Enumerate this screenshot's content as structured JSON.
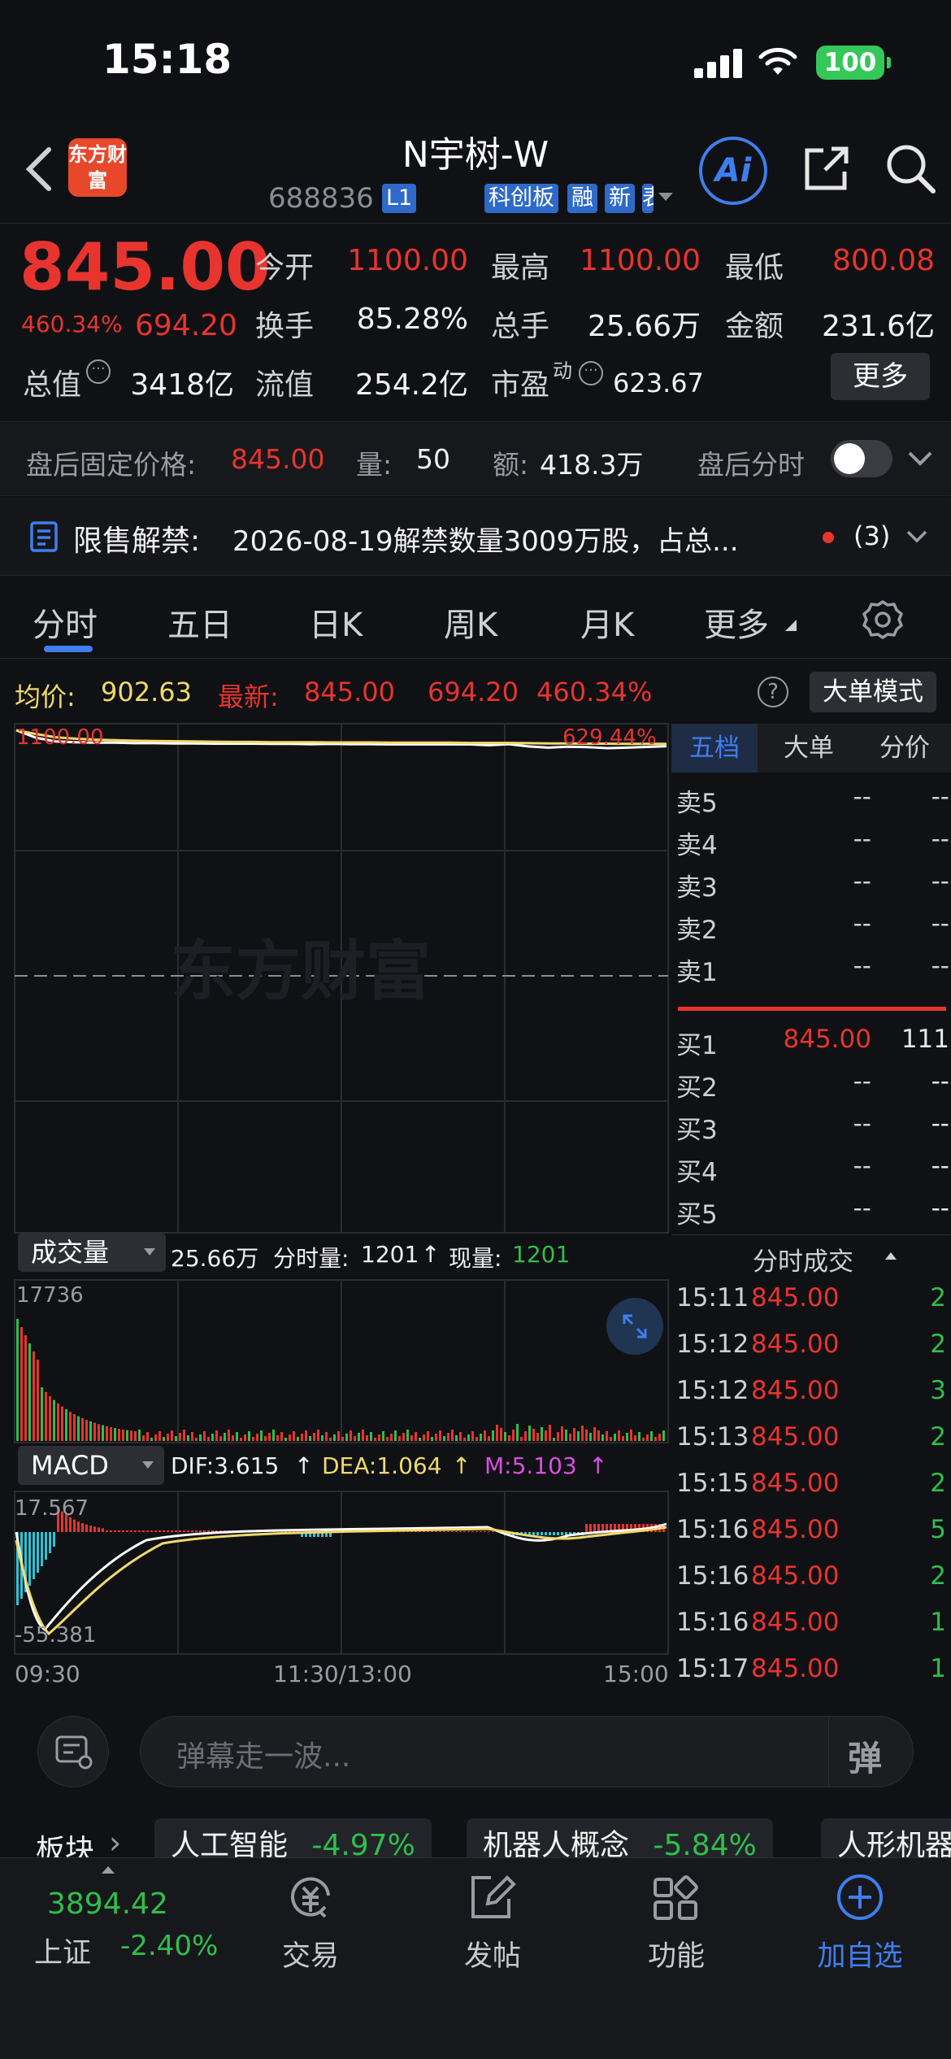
{
  "status_bar": {
    "time": "15:18",
    "battery": "100"
  },
  "header": {
    "stock_name": "N宇树-W",
    "stock_code": "688836",
    "tags": [
      "L1",
      "科创板",
      "融",
      "新",
      "表"
    ],
    "logo_text": "东方财富"
  },
  "quote": {
    "price": "845.00",
    "change_pct": "460.34%",
    "change": "694.20",
    "open_label": "今开",
    "open": "1100.00",
    "high_label": "最高",
    "high": "1100.00",
    "low_label": "最低",
    "low": "800.08",
    "turnover_label": "换手",
    "turnover": "85.28%",
    "volume_label": "总手",
    "volume": "25.66万",
    "amount_label": "金额",
    "amount": "231.6亿",
    "mktcap_label": "总值",
    "mktcap": "3418亿",
    "float_label": "流值",
    "float_cap": "254.2亿",
    "pe_label": "市盈",
    "pe_sup": "动",
    "pe": "623.67",
    "more_button": "更多"
  },
  "after_hours": {
    "label": "盘后固定价格:",
    "price": "845.00",
    "vol_label": "量:",
    "vol": "50",
    "amt_label": "额:",
    "amt": "418.3万",
    "timeshare_label": "盘后分时"
  },
  "restrict_notice": {
    "label": "限售解禁:",
    "text": "2026-08-19解禁数量3009万股，占总...",
    "count": "(3)"
  },
  "tabs": [
    "分时",
    "五日",
    "日K",
    "周K",
    "月K",
    "更多"
  ],
  "chart_legend": {
    "avg_label": "均价:",
    "avg": "902.63",
    "latest_label": "最新:",
    "latest": "845.00",
    "change": "694.20",
    "pct": "460.34%",
    "mode_button": "大单模式"
  },
  "chart_labels": {
    "top_price": "1100.00",
    "top_pct": "629.44%",
    "vol_selector": "成交量",
    "vol_total": "25.66万",
    "vol_minute_label": "分时量:",
    "vol_minute": "1201",
    "vol_now_label": "现量:",
    "vol_now": "1201",
    "vol_max": "17736",
    "macd_selector": "MACD",
    "dif": "DIF:3.615",
    "dea": "DEA:1.064",
    "m": "M:5.103",
    "macd_top": "17.567",
    "macd_bottom": "-55.381",
    "x_start": "09:30",
    "x_mid": "11:30/13:00",
    "x_end": "15:00",
    "watermark": "东方财富"
  },
  "chart_data": {
    "type": "line",
    "title": "",
    "xlabel": "",
    "ylabel": "",
    "x": [
      "09:30",
      "11:30/13:00",
      "15:00"
    ],
    "ylim": [
      800.08,
      1100.0
    ],
    "series": [
      {
        "name": "价格",
        "color": "#ffffff",
        "values": [
          1100,
          1070,
          1055,
          1052,
          1050,
          1050,
          1048,
          1048,
          1047,
          1047,
          1046,
          1046,
          1046,
          1045,
          1045,
          1044,
          1045,
          1044,
          1044,
          1043,
          1043,
          1043,
          1043,
          1043,
          1040,
          1044,
          1035,
          1030,
          1034,
          1032,
          1028,
          1030,
          1033,
          1036
        ]
      },
      {
        "name": "均价",
        "color": "#f0d96b",
        "values": [
          1100,
          1085,
          1072,
          1066,
          1062,
          1060,
          1058,
          1057,
          1056,
          1055,
          1054,
          1053,
          1053,
          1052,
          1052,
          1052,
          1051,
          1051,
          1051,
          1050,
          1050,
          1050,
          1050,
          1049,
          1049,
          1049,
          1048,
          1047,
          1047,
          1046,
          1046,
          1045,
          1045,
          1045
        ]
      }
    ]
  },
  "order_book": {
    "tabs": [
      "五档",
      "大单",
      "分价"
    ],
    "asks": [
      {
        "label": "卖5",
        "price": "--",
        "vol": "--"
      },
      {
        "label": "卖4",
        "price": "--",
        "vol": "--"
      },
      {
        "label": "卖3",
        "price": "--",
        "vol": "--"
      },
      {
        "label": "卖2",
        "price": "--",
        "vol": "--"
      },
      {
        "label": "卖1",
        "price": "--",
        "vol": "--"
      }
    ],
    "bids": [
      {
        "label": "买1",
        "price": "845.00",
        "vol": "111"
      },
      {
        "label": "买2",
        "price": "--",
        "vol": "--"
      },
      {
        "label": "买3",
        "price": "--",
        "vol": "--"
      },
      {
        "label": "买4",
        "price": "--",
        "vol": "--"
      },
      {
        "label": "买5",
        "price": "--",
        "vol": "--"
      }
    ]
  },
  "trades": {
    "title": "分时成交",
    "rows": [
      {
        "time": "15:11",
        "price": "845.00",
        "vol": "2"
      },
      {
        "time": "15:12",
        "price": "845.00",
        "vol": "2"
      },
      {
        "time": "15:12",
        "price": "845.00",
        "vol": "3"
      },
      {
        "time": "15:13",
        "price": "845.00",
        "vol": "2"
      },
      {
        "time": "15:15",
        "price": "845.00",
        "vol": "2"
      },
      {
        "time": "15:16",
        "price": "845.00",
        "vol": "5"
      },
      {
        "time": "15:16",
        "price": "845.00",
        "vol": "2"
      },
      {
        "time": "15:16",
        "price": "845.00",
        "vol": "1"
      },
      {
        "time": "15:17",
        "price": "845.00",
        "vol": "1"
      }
    ]
  },
  "danmu": {
    "placeholder": "弹幕走一波...",
    "button": "弹"
  },
  "sectors": {
    "label": "板块",
    "items": [
      {
        "name": "人工智能",
        "pct": "-4.97%"
      },
      {
        "name": "机器人概念",
        "pct": "-5.84%"
      },
      {
        "name": "人形机器",
        "pct": ""
      }
    ]
  },
  "bottom_nav": {
    "index_value": "3894.42",
    "index_name": "上证",
    "index_pct": "-2.40%",
    "items": [
      "交易",
      "发帖",
      "功能",
      "加自选"
    ]
  }
}
